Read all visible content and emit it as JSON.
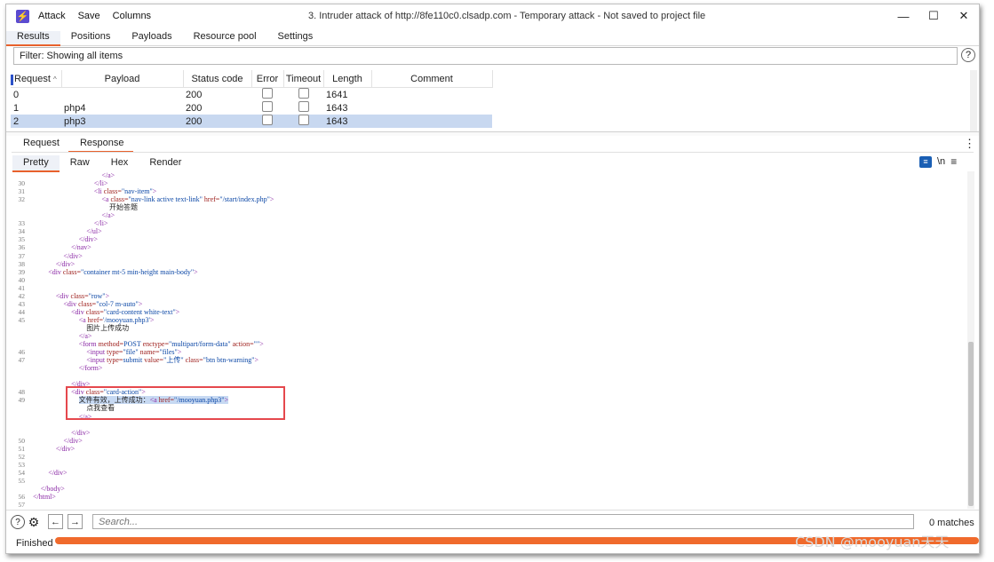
{
  "menu": {
    "attack": "Attack",
    "save": "Save",
    "columns": "Columns"
  },
  "window_title": "3. Intruder attack of http://8fe110c0.clsadp.com - Temporary attack - Not saved to project file",
  "main_tabs": [
    "Results",
    "Positions",
    "Payloads",
    "Resource pool",
    "Settings"
  ],
  "filter": "Filter: Showing all items",
  "table": {
    "headers": [
      "Request",
      "Payload",
      "Status code",
      "Error",
      "Timeout",
      "Length",
      "Comment"
    ],
    "rows": [
      {
        "request": "0",
        "payload": "",
        "status": "200",
        "length": "1641"
      },
      {
        "request": "1",
        "payload": "php4",
        "status": "200",
        "length": "1643"
      },
      {
        "request": "2",
        "payload": "php3",
        "status": "200",
        "length": "1643"
      }
    ]
  },
  "rr_tabs": [
    "Request",
    "Response"
  ],
  "view_tabs": [
    "Pretty",
    "Raw",
    "Hex",
    "Render"
  ],
  "view_icon_newline": "\\n",
  "search": {
    "placeholder": "Search...",
    "matches": "0 matches"
  },
  "status": "Finished",
  "watermark": "CSDN @mooyuan天天",
  "code_lines": [
    {
      "n": "",
      "i": 9,
      "h": "<span class='tag'>&lt;/a&gt;</span>"
    },
    {
      "n": "30",
      "i": 8,
      "h": "<span class='tag'>&lt;/li&gt;</span>"
    },
    {
      "n": "31",
      "i": 8,
      "h": "<span class='tag'>&lt;li </span><span class='attr'>class=</span><span class='val'>\"nav-item\"</span><span class='tag'>&gt;</span>"
    },
    {
      "n": "32",
      "i": 9,
      "h": "<span class='tag'>&lt;a </span><span class='attr'>class=</span><span class='val'>\"nav-link active text-link\"</span> <span class='attr'>href=</span><span class='val'>\"/start/index.php\"</span><span class='tag'>&gt;</span>"
    },
    {
      "n": "",
      "i": 10,
      "h": "<span class='txt'>开始答题</span>"
    },
    {
      "n": "",
      "i": 9,
      "h": "<span class='tag'>&lt;/a&gt;</span>"
    },
    {
      "n": "33",
      "i": 8,
      "h": "<span class='tag'>&lt;/li&gt;</span>"
    },
    {
      "n": "34",
      "i": 7,
      "h": "<span class='tag'>&lt;/ul&gt;</span>"
    },
    {
      "n": "35",
      "i": 6,
      "h": "<span class='tag'>&lt;/div&gt;</span>"
    },
    {
      "n": "36",
      "i": 5,
      "h": "<span class='tag'>&lt;/nav&gt;</span>"
    },
    {
      "n": "37",
      "i": 4,
      "h": "<span class='tag'>&lt;/div&gt;</span>"
    },
    {
      "n": "38",
      "i": 3,
      "h": "<span class='tag'>&lt;/div&gt;</span>"
    },
    {
      "n": "39",
      "i": 2,
      "h": "<span class='tag'>&lt;div </span><span class='attr'>class=</span><span class='val'>\"container mt-5 min-height main-body\"</span><span class='tag'>&gt;</span>"
    },
    {
      "n": "40",
      "i": 0,
      "h": ""
    },
    {
      "n": "41",
      "i": 0,
      "h": ""
    },
    {
      "n": "42",
      "i": 3,
      "h": "<span class='tag'>&lt;div </span><span class='attr'>class=</span><span class='val'>\"row\"</span><span class='tag'>&gt;</span>"
    },
    {
      "n": "43",
      "i": 4,
      "h": "<span class='tag'>&lt;div </span><span class='attr'>class=</span><span class='val'>\"col-7 m-auto\"</span><span class='tag'>&gt;</span>"
    },
    {
      "n": "44",
      "i": 5,
      "h": "<span class='tag'>&lt;div </span><span class='attr'>class=</span><span class='val'>\"card-content white-text\"</span><span class='tag'>&gt;</span>"
    },
    {
      "n": "45",
      "i": 6,
      "h": "<span class='tag'>&lt;a </span><span class='attr'>href=</span><span class='val'>'/mooyuan.php3'</span><span class='tag'>&gt;</span>"
    },
    {
      "n": "",
      "i": 7,
      "h": "<span class='txt'>图片上传成功</span>"
    },
    {
      "n": "",
      "i": 6,
      "h": "<span class='tag'>&lt;/a&gt;</span>"
    },
    {
      "n": "",
      "i": 6,
      "h": "<span class='tag'>&lt;form </span><span class='attr'>method=</span><span class='val'>POST</span> <span class='attr'>enctype=</span><span class='val'>\"multipart/form-data\"</span> <span class='attr'>action=</span><span class='val'>\"\"</span><span class='tag'>&gt;</span>"
    },
    {
      "n": "46",
      "i": 7,
      "h": "<span class='tag'>&lt;input </span><span class='attr'>type=</span><span class='val'>\"file\"</span> <span class='attr'>name=</span><span class='val'>\"files\"</span><span class='tag'>&gt;</span>"
    },
    {
      "n": "47",
      "i": 7,
      "h": "<span class='tag'>&lt;input </span><span class='attr'>type=</span><span class='val'>submit</span> <span class='attr'>value=</span><span class='val'>\"上传\"</span> <span class='attr'>class=</span><span class='val'>\"btn btn-warning\"</span><span class='tag'>&gt;</span>"
    },
    {
      "n": "",
      "i": 6,
      "h": "<span class='tag'>&lt;/form&gt;</span>"
    },
    {
      "n": "",
      "i": 0,
      "h": ""
    },
    {
      "n": "",
      "i": 5,
      "h": "<span class='tag'>&lt;/div&gt;</span>"
    },
    {
      "n": "48",
      "i": 5,
      "h": "<span class='tag'>&lt;div </span><span class='attr'>class=</span><span class='val'>\"card-action\"</span><span class='tag'>&gt;</span>"
    },
    {
      "n": "49",
      "i": 6,
      "h": "<span class='hl'><span class='txt'>文件有效，上传成功：</span><span class='tag'>&lt;a </span><span class='attr'>href=</span><span class='val'>\"/mooyuan.php3\"</span><span class='tag'>&gt;</span></span>"
    },
    {
      "n": "",
      "i": 7,
      "h": "<span class='txt'>点我查看</span>"
    },
    {
      "n": "",
      "i": 6,
      "h": "<span class='tag'>&lt;/a&gt;</span>"
    },
    {
      "n": "",
      "i": 0,
      "h": ""
    },
    {
      "n": "",
      "i": 5,
      "h": "<span class='tag'>&lt;/div&gt;</span>"
    },
    {
      "n": "50",
      "i": 4,
      "h": "<span class='tag'>&lt;/div&gt;</span>"
    },
    {
      "n": "51",
      "i": 3,
      "h": "<span class='tag'>&lt;/div&gt;</span>"
    },
    {
      "n": "52",
      "i": 0,
      "h": ""
    },
    {
      "n": "53",
      "i": 0,
      "h": ""
    },
    {
      "n": "54",
      "i": 2,
      "h": "<span class='tag'>&lt;/div&gt;</span>"
    },
    {
      "n": "55",
      "i": 0,
      "h": ""
    },
    {
      "n": "",
      "i": 1,
      "h": "<span class='tag'>&lt;/body&gt;</span>"
    },
    {
      "n": "56",
      "i": 0,
      "h": "<span class='tag'>&lt;/html&gt;</span>"
    },
    {
      "n": "57",
      "i": 0,
      "h": ""
    }
  ]
}
